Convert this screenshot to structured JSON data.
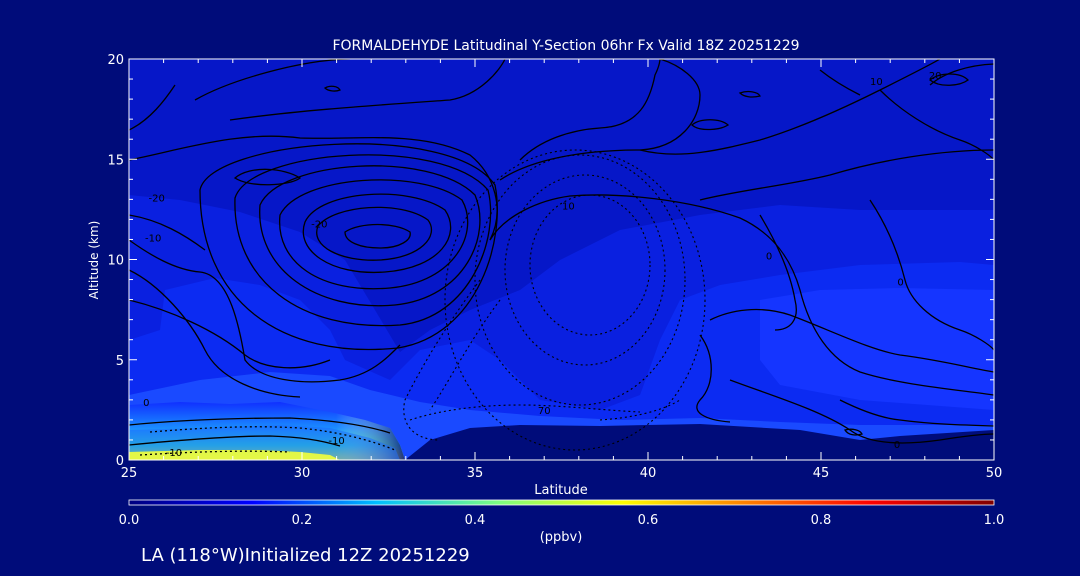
{
  "chart_data": {
    "type": "contour",
    "title": "FORMALDEHYDE Latitudinal Y-Section 06hr  Fx Valid 18Z 20251229",
    "xlabel": "Latitude",
    "ylabel": "Altitude (km)",
    "xlim": [
      25,
      50
    ],
    "ylim": [
      0,
      20
    ],
    "x_ticks": [
      25,
      30,
      35,
      40,
      45,
      50
    ],
    "y_ticks": [
      0,
      5,
      10,
      15,
      20
    ],
    "colorbar": {
      "label": "(ppbv)",
      "range": [
        0.0,
        1.0
      ],
      "ticks": [
        "0.0",
        "0.2",
        "0.4",
        "0.6",
        "0.8",
        "1.0"
      ],
      "colormap": [
        "#00007f",
        "#0000ff",
        "#00bfff",
        "#7fff7f",
        "#ffff00",
        "#ff7f00",
        "#ff0000",
        "#7f0000"
      ]
    },
    "contour_labels": [
      {
        "text": "0",
        "lat": 25.5,
        "alt": 2.7
      },
      {
        "text": "-10",
        "lat": 26.3,
        "alt": 0.2
      },
      {
        "text": "-10",
        "lat": 31.0,
        "alt": 0.8
      },
      {
        "text": "-10",
        "lat": 25.7,
        "alt": 10.9
      },
      {
        "text": "-20",
        "lat": 25.8,
        "alt": 12.9
      },
      {
        "text": "-20",
        "lat": 30.5,
        "alt": 11.6
      },
      {
        "text": "10",
        "lat": 37.7,
        "alt": 12.5
      },
      {
        "text": "70",
        "lat": 37.0,
        "alt": 2.3
      },
      {
        "text": "0",
        "lat": 43.5,
        "alt": 10.0
      },
      {
        "text": "0",
        "lat": 47.3,
        "alt": 8.7
      },
      {
        "text": "0",
        "lat": 47.2,
        "alt": 0.6
      },
      {
        "text": "10",
        "lat": 46.6,
        "alt": 18.7
      },
      {
        "text": "20",
        "lat": 48.3,
        "alt": 19.0
      }
    ]
  },
  "footer": {
    "caption": "LA (118°W)Initialized 12Z 20251229"
  }
}
